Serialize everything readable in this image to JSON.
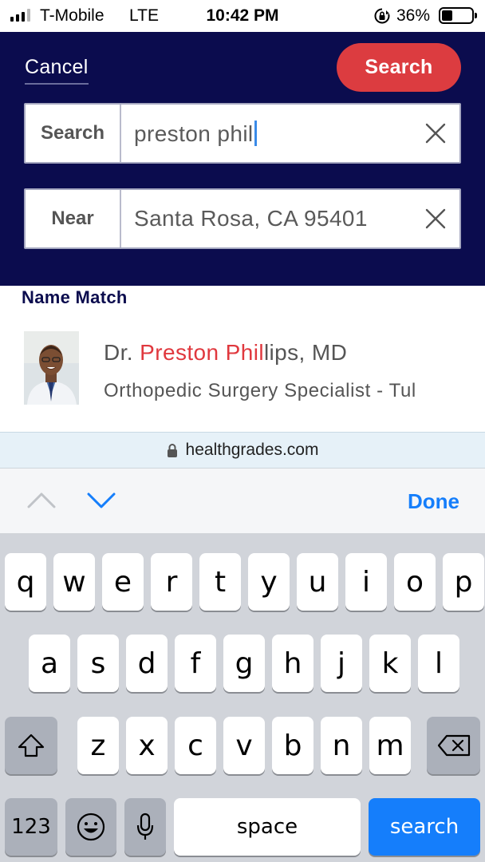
{
  "status": {
    "carrier": "T-Mobile",
    "network": "LTE",
    "time": "10:42 PM",
    "battery": "36%",
    "battery_level": 0.36,
    "signal_bars": 3,
    "icons": [
      "signal-icon",
      "orientation-lock-icon",
      "battery-icon"
    ]
  },
  "header": {
    "cancel_label": "Cancel",
    "search_button_label": "Search",
    "search_field": {
      "label": "Search",
      "value": "preston phil"
    },
    "near_field": {
      "label": "Near",
      "value": "Santa Rosa, CA 95401"
    },
    "clear_icon": "close-icon",
    "colors": {
      "background": "#0b0c4e",
      "accent": "#dc3c40"
    }
  },
  "results": {
    "section_title": "Name Match",
    "items": [
      {
        "name_prefix": "Dr. ",
        "name_match": "Preston Phil",
        "name_rest": "lips, MD",
        "specialty": "Orthopedic Surgery Specialist - Tul"
      }
    ],
    "highlight_color": "#e0383e"
  },
  "browser": {
    "url": "healthgrades.com",
    "lock_icon": "lock-icon"
  },
  "accessory": {
    "prev_icon": "chevron-up-icon",
    "next_icon": "chevron-down-icon",
    "done_label": "Done"
  },
  "keyboard": {
    "row1": [
      "q",
      "w",
      "e",
      "r",
      "t",
      "y",
      "u",
      "i",
      "o",
      "p"
    ],
    "row2": [
      "a",
      "s",
      "d",
      "f",
      "g",
      "h",
      "j",
      "k",
      "l"
    ],
    "row3": [
      "z",
      "x",
      "c",
      "v",
      "b",
      "n",
      "m"
    ],
    "numbers_label": "123",
    "space_label": "space",
    "return_label": "search",
    "icons": [
      "shift-icon",
      "backspace-icon",
      "emoji-icon",
      "microphone-icon"
    ]
  }
}
